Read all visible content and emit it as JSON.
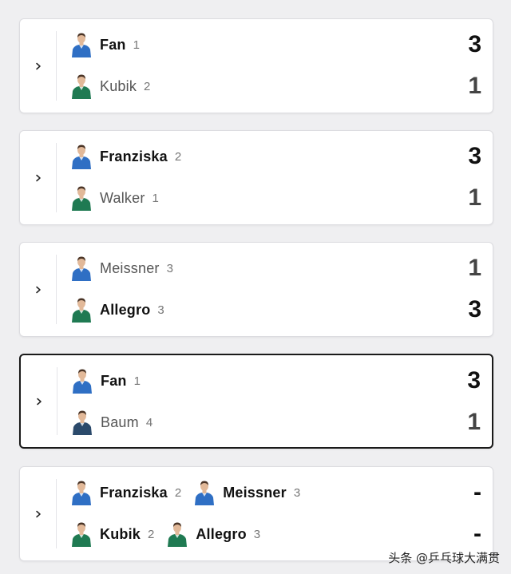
{
  "matches": [
    {
      "selected": false,
      "rows": [
        {
          "players": [
            {
              "name": "Fan",
              "seed": "1",
              "kit": "blue"
            }
          ],
          "score": "3",
          "win": true
        },
        {
          "players": [
            {
              "name": "Kubik",
              "seed": "2",
              "kit": "green"
            }
          ],
          "score": "1",
          "win": false
        }
      ]
    },
    {
      "selected": false,
      "rows": [
        {
          "players": [
            {
              "name": "Franziska",
              "seed": "2",
              "kit": "blue"
            }
          ],
          "score": "3",
          "win": true
        },
        {
          "players": [
            {
              "name": "Walker",
              "seed": "1",
              "kit": "green"
            }
          ],
          "score": "1",
          "win": false
        }
      ]
    },
    {
      "selected": false,
      "rows": [
        {
          "players": [
            {
              "name": "Meissner",
              "seed": "3",
              "kit": "blue"
            }
          ],
          "score": "1",
          "win": false
        },
        {
          "players": [
            {
              "name": "Allegro",
              "seed": "3",
              "kit": "green"
            }
          ],
          "score": "3",
          "win": true
        }
      ]
    },
    {
      "selected": true,
      "rows": [
        {
          "players": [
            {
              "name": "Fan",
              "seed": "1",
              "kit": "blue"
            }
          ],
          "score": "3",
          "win": true
        },
        {
          "players": [
            {
              "name": "Baum",
              "seed": "4",
              "kit": "navy"
            }
          ],
          "score": "1",
          "win": false
        }
      ]
    },
    {
      "selected": false,
      "rows": [
        {
          "players": [
            {
              "name": "Franziska",
              "seed": "2",
              "kit": "blue"
            },
            {
              "name": "Meissner",
              "seed": "3",
              "kit": "blue"
            }
          ],
          "score": "-",
          "win": true
        },
        {
          "players": [
            {
              "name": "Kubik",
              "seed": "2",
              "kit": "green"
            },
            {
              "name": "Allegro",
              "seed": "3",
              "kit": "green"
            }
          ],
          "score": "-",
          "win": true
        }
      ]
    }
  ],
  "watermark": "头条 @乒乓球大满贯",
  "colors": {
    "blue_kit": "#2f6fc4",
    "green_kit": "#1f7a52",
    "navy_kit": "#2b4a6b",
    "skin": "#e2b999",
    "hair": "#4a3426"
  }
}
